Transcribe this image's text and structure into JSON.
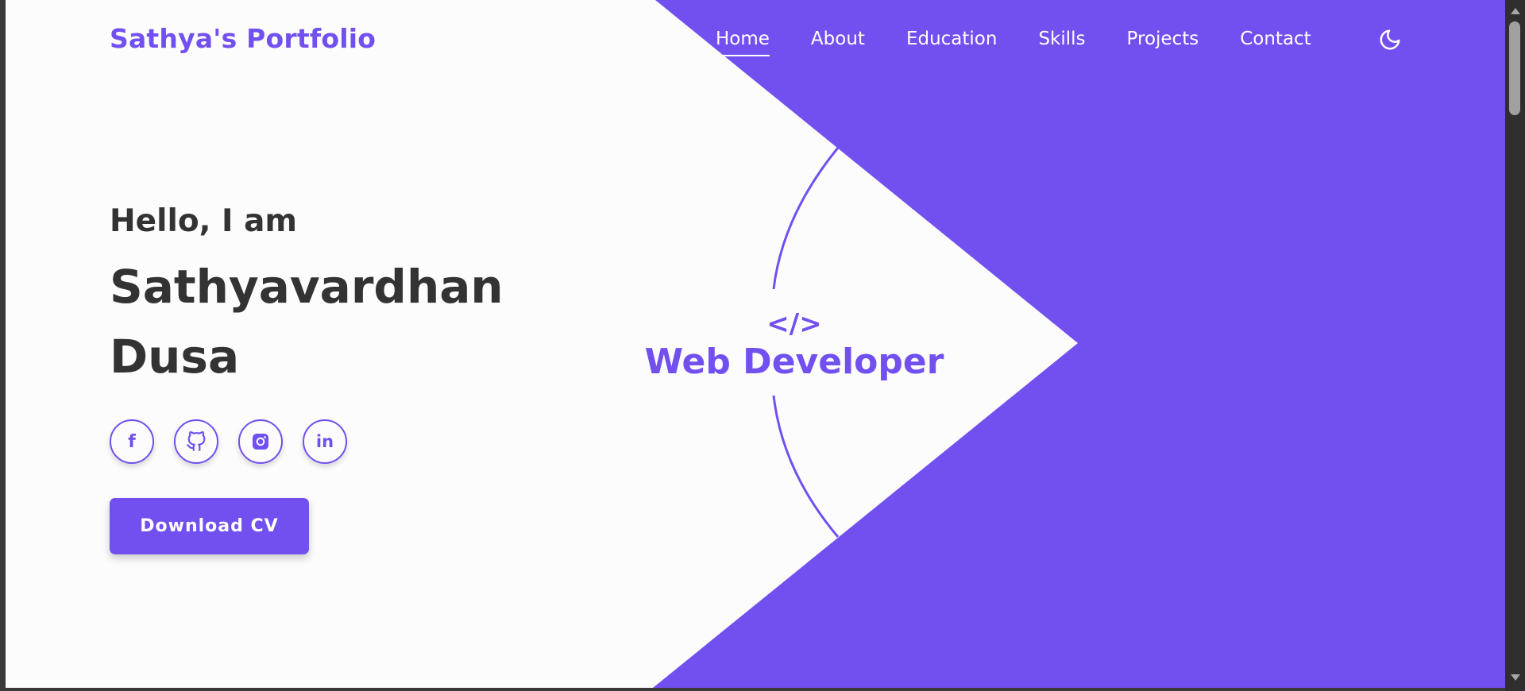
{
  "colors": {
    "accent": "#7250f0",
    "text_dark": "#333333",
    "background": "#fcfcfc",
    "nav_text": "#ffffff"
  },
  "navbar": {
    "logo": "Sathya's Portfolio",
    "links": [
      "Home",
      "About",
      "Education",
      "Skills",
      "Projects",
      "Contact"
    ],
    "active_link": "Home",
    "theme_toggle_icon": "moon-icon"
  },
  "hero": {
    "greeting": "Hello, I am",
    "name_line1": "Sathyavardhan",
    "name_line2": "Dusa",
    "socials": [
      {
        "icon": "facebook-icon"
      },
      {
        "icon": "github-icon"
      },
      {
        "icon": "instagram-icon"
      },
      {
        "icon": "linkedin-icon"
      }
    ],
    "cv_button": "Download CV",
    "role_icon": "</>",
    "role_title": "Web Developer"
  }
}
